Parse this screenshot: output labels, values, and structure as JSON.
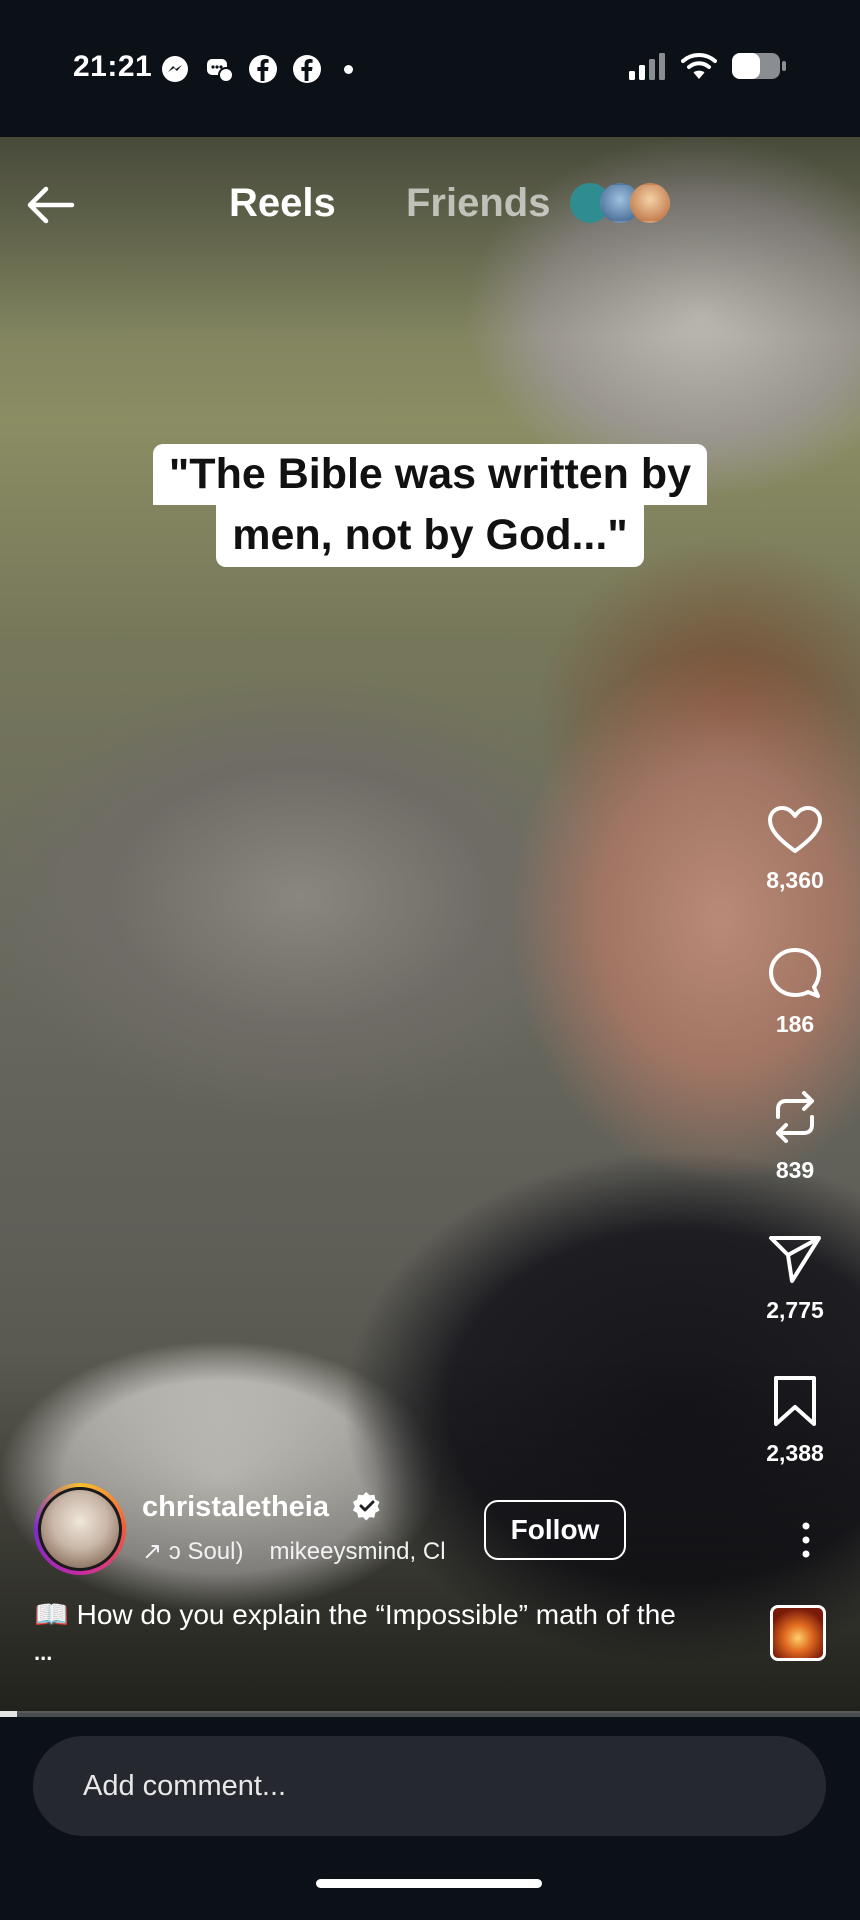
{
  "status_bar": {
    "time": "21:21",
    "left_icons": [
      "messenger-icon",
      "messenger-chat-icon",
      "facebook-icon",
      "facebook-icon"
    ],
    "right_icons": [
      "signal-icon",
      "wifi-icon",
      "battery-icon"
    ]
  },
  "header": {
    "tabs": [
      {
        "label": "Reels",
        "active": true
      },
      {
        "label": "Friends",
        "active": false
      }
    ]
  },
  "video": {
    "caption_line_1": "\"The Bible was written by",
    "caption_line_2": "men, not by God...\"",
    "progress": 0.02
  },
  "actions": {
    "likes": "8,360",
    "comments": "186",
    "reposts": "839",
    "shares": "2,775",
    "saves": "2,388"
  },
  "author": {
    "username": "christaletheia",
    "verified": true,
    "audio": "↗ ɔ Soul)",
    "collaborators": "mikeeysmind, Cl",
    "follow_label": "Follow"
  },
  "description": {
    "text": "📖 How do you explain the “Impossible” math of the",
    "more": "..."
  },
  "comment": {
    "placeholder": "Add comment..."
  },
  "colors": {
    "background": "#0c1117",
    "comment_box": "#26282f",
    "caption_bg": "#ffffff"
  }
}
